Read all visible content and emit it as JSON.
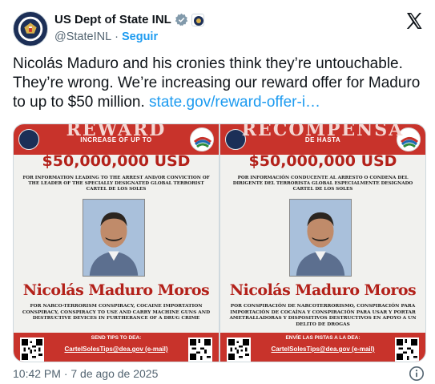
{
  "account": {
    "display_name": "US Dept of State INL",
    "handle": "@StateINL",
    "separator": "·",
    "follow_label": "Seguir"
  },
  "tweet": {
    "text": "Nicolás Maduro and his cronies think they’re untouchable. They’re wrong. We’re increasing our reward offer for Maduro to up to $50 million. ",
    "link_text": "state.gov/reward-offer-i…"
  },
  "posters": [
    {
      "headline": "REWARD",
      "subhead": "INCREASE OF UP TO",
      "amount": "$50,000,000 USD",
      "info": "FOR INFORMATION LEADING TO THE ARREST AND/OR CONVICTION OF THE LEADER OF THE SPECIALLY DESIGNATED GLOBAL TERRORIST CARTEL DE LOS SOLES",
      "name": "Nicolás Maduro Moros",
      "charges": "FOR NARCO-TERRORISM CONSPIRACY, COCAINE IMPORTATION CONSPIRACY, CONSPIRACY TO USE AND CARRY MACHINE GUNS AND DESTRUCTIVE DEVICES IN FURTHERANCE OF A DRUG CRIME",
      "tips_label": "SEND TIPS TO DEA:",
      "tips_email": "CartelSolesTips@dea.gov (e-mail)"
    },
    {
      "headline": "RECOMPENSA",
      "subhead": "DE HASTA",
      "amount": "$50,000,000 USD",
      "info": "POR INFORMACIÓN CONDUCENTE AL ARRESTO O CONDENA DEL DIRIGENTE DEL TERRORISTA GLOBAL ESPECIALMENTE DESIGNADO CARTEL DE LOS SOLES",
      "name": "Nicolás Maduro Moros",
      "charges": "POR CONSPIRACIÓN DE NARCOTERRORISMO, CONSPIRACIÓN PARA IMPORTACIÓN DE COCAÍNA Y CONSPIRACIÓN PARA USAR Y PORTAR AMETRALLADORAS Y DISPOSITIVOS DESTRUCTIVOS EN APOYO A UN DELITO DE DROGAS",
      "tips_label": "ENVÍE LAS PISTAS A LA DEA:",
      "tips_email": "CartelSolesTips@dea.gov (e-mail)"
    }
  ],
  "footer": {
    "timestamp": "10:42 PM · 7 de ago de 2025"
  },
  "icons": {
    "avatar": "state-department-seal-icon",
    "verified": "verified-badge-icon",
    "affiliate": "affiliate-seal-icon",
    "x_logo": "x-logo-icon",
    "info": "info-icon"
  },
  "colors": {
    "link": "#1d9bf0",
    "muted": "#536471",
    "text": "#0f1419",
    "poster_red": "#c8332b",
    "verified": "#829aab"
  }
}
